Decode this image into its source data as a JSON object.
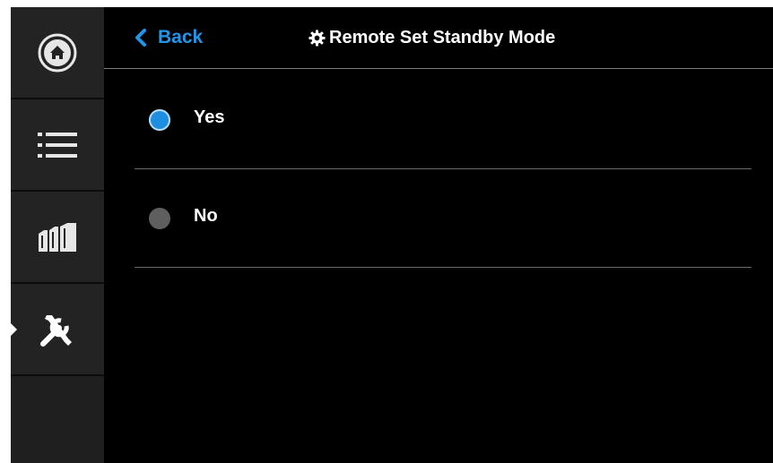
{
  "header": {
    "back_label": "Back",
    "title": "Remote Set Standby Mode"
  },
  "sidebar": {
    "items": [
      {
        "name": "home",
        "icon": "home-icon",
        "active": false
      },
      {
        "name": "menu",
        "icon": "list-icon",
        "active": false
      },
      {
        "name": "machines",
        "icon": "machines-icon",
        "active": false
      },
      {
        "name": "settings",
        "icon": "tools-icon",
        "active": true
      },
      {
        "name": "empty",
        "icon": "",
        "active": false
      }
    ]
  },
  "options": [
    {
      "label": "Yes",
      "selected": true
    },
    {
      "label": "No",
      "selected": false
    }
  ],
  "colors": {
    "accent": "#2196e8",
    "background": "#000000",
    "sidebar": "#232323",
    "radio_off": "#5f5f5f"
  }
}
